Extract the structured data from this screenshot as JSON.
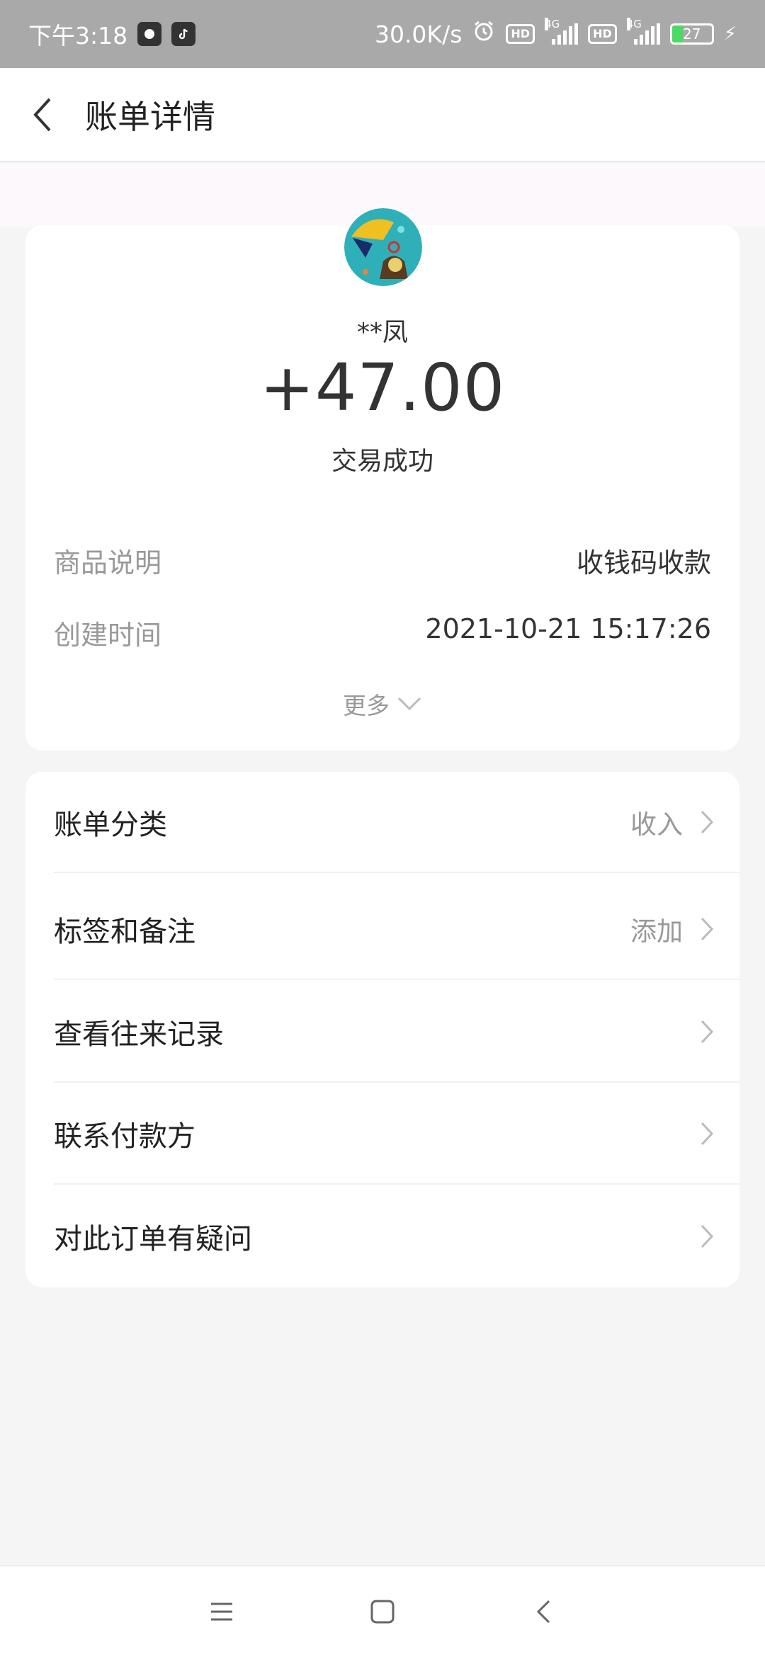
{
  "status_bar": {
    "time": "下午3:18",
    "net_speed": "30.0K/s",
    "hd_badge": "HD",
    "network": "4G",
    "battery": "27",
    "battery_level": 0.27
  },
  "header": {
    "title": "账单详情"
  },
  "transaction": {
    "payer": "**凤",
    "amount": "+47.00",
    "status": "交易成功",
    "details": [
      {
        "label": "商品说明",
        "value": "收钱码收款"
      },
      {
        "label": "创建时间",
        "value": "2021-10-21 15:17:26"
      }
    ],
    "more_label": "更多"
  },
  "menu": {
    "items": [
      {
        "label": "账单分类",
        "value": "收入"
      },
      {
        "label": "标签和备注",
        "value": "添加"
      },
      {
        "label": "查看往来记录",
        "value": ""
      },
      {
        "label": "联系付款方",
        "value": ""
      },
      {
        "label": "对此订单有疑问",
        "value": ""
      }
    ]
  },
  "icons": {
    "back": "back-arrow-icon",
    "chevron": "chevron-right-icon",
    "more": "chevron-down-icon",
    "nav_menu": "menu-icon",
    "nav_home": "home-square-icon",
    "nav_back": "nav-back-icon"
  }
}
